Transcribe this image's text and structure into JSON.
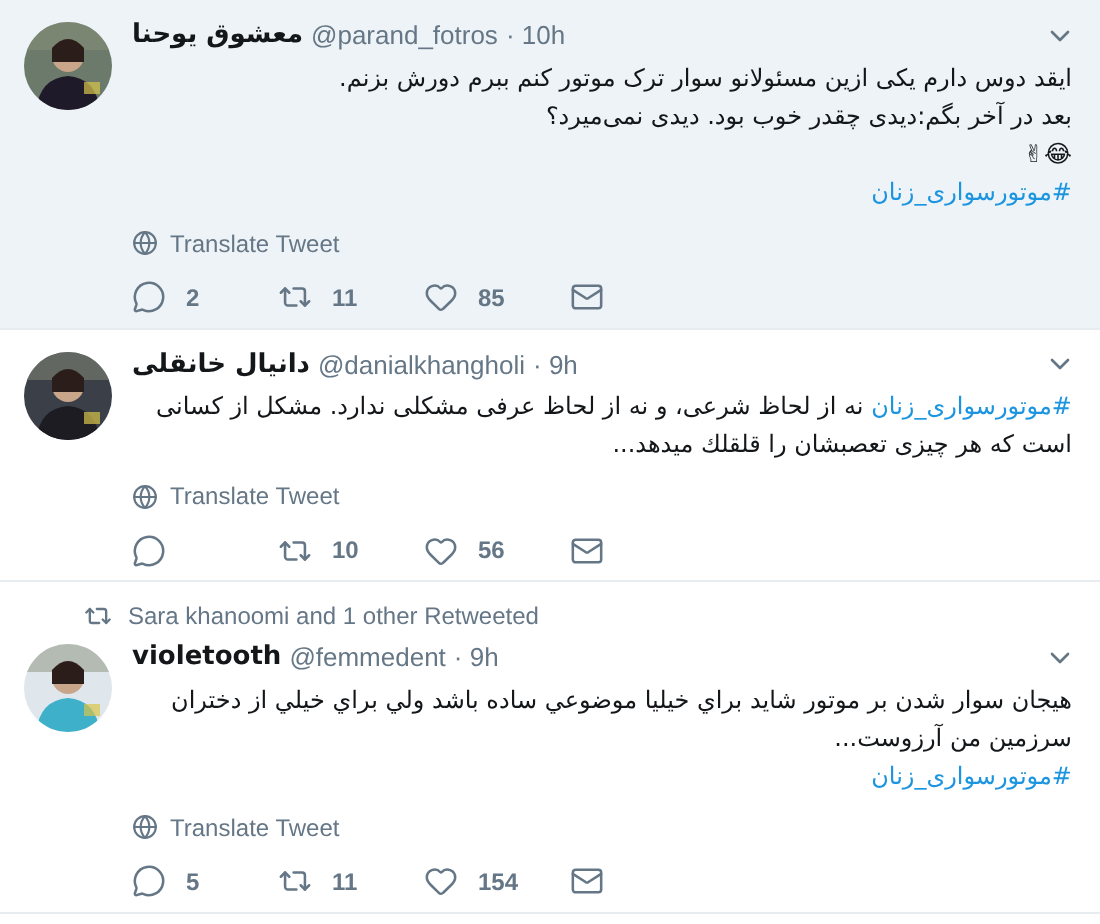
{
  "tweets": [
    {
      "highlighted": true,
      "display_name": "معشوق یوحنا",
      "handle": "@parand_fotros",
      "time": "· 10h",
      "body": [
        [
          {
            "kind": "text",
            "text": "ایقد دوس دارم یکی ازین مسئولانو سوار ترک موتور کنم ببرم دورش بزنم."
          }
        ],
        [
          {
            "kind": "text",
            "text": "بعد در آخر بگم:دیدی چقدر خوب بود. دیدی نمی‌میرد؟"
          }
        ],
        [
          {
            "kind": "text",
            "text": "😂✌"
          }
        ],
        [
          {
            "kind": "hashtag",
            "text": "#موتورسواری_زنان"
          }
        ]
      ],
      "translate": "Translate Tweet",
      "replies": "2",
      "retweets": "11",
      "likes": "85"
    },
    {
      "highlighted": false,
      "display_name": "دانیال خانقلی",
      "handle": "@danialkhangholi",
      "time": "· 9h",
      "body": [
        [
          {
            "kind": "hashtag",
            "text": "#موتورسواری_زنان"
          },
          {
            "kind": "text",
            "text": " نه از لحاظ شرعی، و نه از لحاظ عرفی مشکلی ندارد. مشکل از کسانی است که هر چیزی تعصبشان را قلقلك میدهد..."
          }
        ]
      ],
      "translate": "Translate Tweet",
      "retweets": "10",
      "likes": "56"
    },
    {
      "highlighted": false,
      "social_context": "Sara khanoomi and 1 other Retweeted",
      "display_name": "violetooth",
      "handle": "@femmedent",
      "time": "· 9h",
      "body": [
        [
          {
            "kind": "text",
            "text": "هیجان سوار شدن بر موتور شاید براي خیلیا موضوعي ساده باشد ولي براي خیلي از دختران سرزمین من آرزوست..."
          }
        ],
        [
          {
            "kind": "hashtag",
            "text": "#موتورسواری_زنان"
          }
        ]
      ],
      "translate": "Translate Tweet",
      "replies": "5",
      "retweets": "11",
      "likes": "154"
    }
  ]
}
